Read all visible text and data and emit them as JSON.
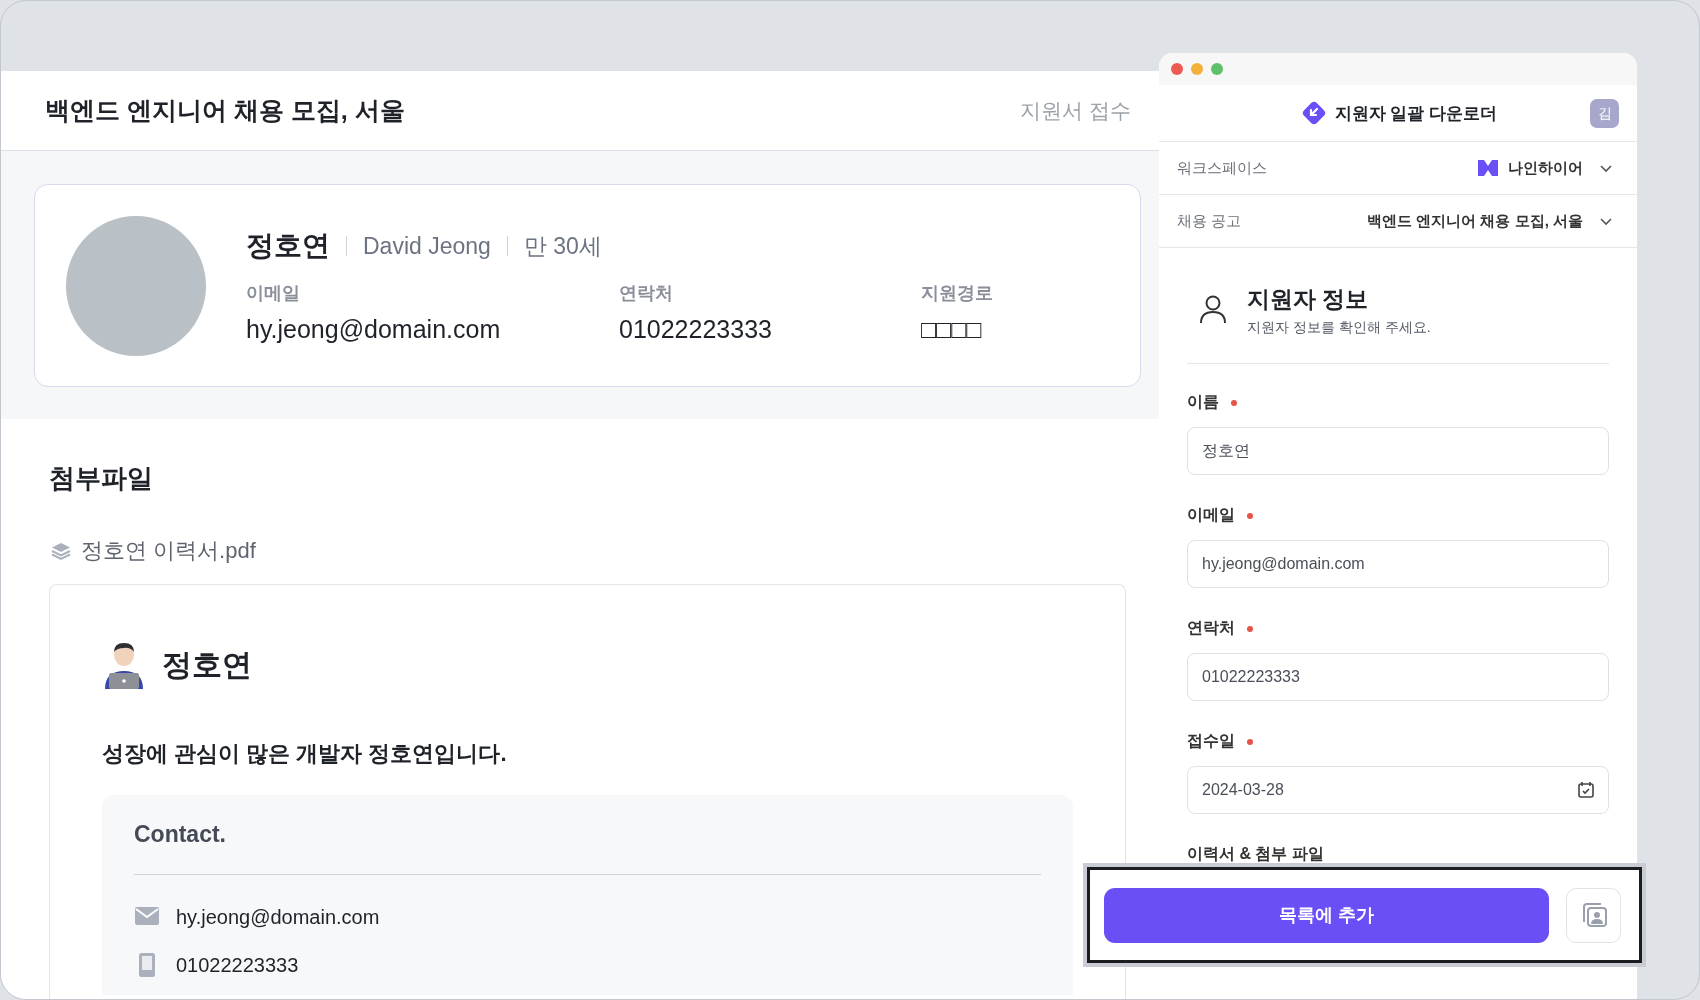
{
  "job_page": {
    "title": "백엔드 엔지니어 채용 모집, 서울",
    "status": "지원서 접수"
  },
  "profile": {
    "name": "정호연",
    "english_name": "David Jeong",
    "age": "만 30세",
    "fields": [
      {
        "label": "이메일",
        "value": "hy.jeong@domain.com"
      },
      {
        "label": "연락처",
        "value": "01022223333"
      },
      {
        "label": "지원경로",
        "value": "□□□□"
      }
    ]
  },
  "attachments": {
    "heading": "첨부파일",
    "file_name": "정호연 이력서.pdf",
    "document": {
      "name": "정호연",
      "headline": "성장에 관심이 많은 개발자 정호연입니다.",
      "contact": {
        "heading": "Contact.",
        "items": [
          {
            "kind": "email",
            "text": "hy.jeong@domain.com"
          },
          {
            "kind": "phone",
            "text": "01022223333"
          }
        ]
      }
    }
  },
  "extension": {
    "title": "지원자 일괄 다운로더",
    "avatar_initial": "김",
    "selectors": [
      {
        "kind": "workspace",
        "label": "워크스페이스",
        "value": "나인하이어"
      },
      {
        "kind": "posting",
        "label": "채용 공고",
        "value": "백엔드 엔지니어 채용 모집, 서울"
      }
    ],
    "section": {
      "title": "지원자 정보",
      "subtitle": "지원자 정보를 확인해 주세요."
    },
    "fields": [
      {
        "kind": "text",
        "label": "이름",
        "required": true,
        "value": "정호연"
      },
      {
        "kind": "text",
        "label": "이메일",
        "required": true,
        "value": "hy.jeong@domain.com"
      },
      {
        "kind": "text",
        "label": "연락처",
        "required": true,
        "value": "01022223333"
      },
      {
        "kind": "date",
        "label": "접수일",
        "required": true,
        "value": "2024-03-28"
      },
      {
        "kind": "file",
        "label": "이력서 & 첨부 파일",
        "required": false
      }
    ],
    "primary_button": "목록에 추가"
  }
}
